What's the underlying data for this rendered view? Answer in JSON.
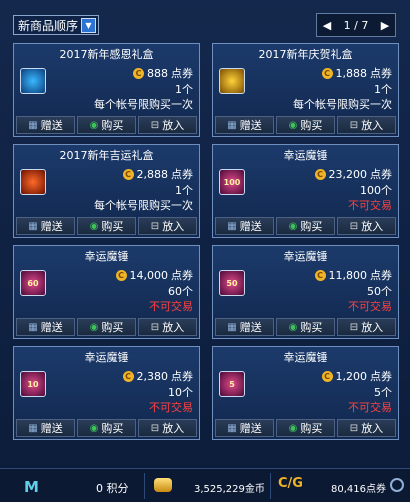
{
  "topbar": {
    "sort_label": "新商品顺序",
    "pager": {
      "current": "1",
      "separator": "/",
      "total": "7",
      "display": "1 / 7"
    }
  },
  "items": [
    {
      "title": "2017新年感恩礼盒",
      "icon": "blue-gift-box-icon",
      "price": "888",
      "currency": "点券",
      "qty": "1个",
      "note": "每个帐号限购买一次",
      "note_color": "#ffffff"
    },
    {
      "title": "2017新年庆贺礼盒",
      "icon": "gold-gift-box-icon",
      "price": "1,888",
      "currency": "点券",
      "qty": "1个",
      "note": "每个帐号限购买一次",
      "note_color": "#ffffff"
    },
    {
      "title": "2017新年吉运礼盒",
      "icon": "red-gift-box-icon",
      "price": "2,888",
      "currency": "点券",
      "qty": "1个",
      "note": "每个帐号限购买一次",
      "note_color": "#ffffff"
    },
    {
      "title": "幸运魔锤",
      "icon": "lucky-hammer-icon",
      "icon_text": "100",
      "price": "23,200",
      "currency": "点券",
      "qty": "100个",
      "note": "不可交易",
      "note_color": "#ff4040"
    },
    {
      "title": "幸运魔锤",
      "icon": "lucky-hammer-icon",
      "icon_text": "60",
      "price": "14,000",
      "currency": "点券",
      "qty": "60个",
      "note": "不可交易",
      "note_color": "#ff4040"
    },
    {
      "title": "幸运魔锤",
      "icon": "lucky-hammer-icon",
      "icon_text": "50",
      "price": "11,800",
      "currency": "点券",
      "qty": "50个",
      "note": "不可交易",
      "note_color": "#ff4040"
    },
    {
      "title": "幸运魔锤",
      "icon": "lucky-hammer-icon",
      "icon_text": "10",
      "price": "2,380",
      "currency": "点券",
      "qty": "10个",
      "note": "不可交易",
      "note_color": "#ff4040"
    },
    {
      "title": "幸运魔锤",
      "icon": "lucky-hammer-icon",
      "icon_text": "5",
      "price": "1,200",
      "currency": "点券",
      "qty": "5个",
      "note": "不可交易",
      "note_color": "#ff4040"
    }
  ],
  "actions": {
    "gift": "赠送",
    "buy": "购买",
    "cart": "放入"
  },
  "bottombar": {
    "logo": "M",
    "points": "0 积分",
    "gold": "3,525,229金币",
    "exchange_glyph": "C/G",
    "cash": "80,416点券"
  },
  "colors": {
    "accent": "#2c73d2",
    "restricted": "#ff4040",
    "coin": "#f0b428",
    "buy_green": "#3ec25a"
  }
}
